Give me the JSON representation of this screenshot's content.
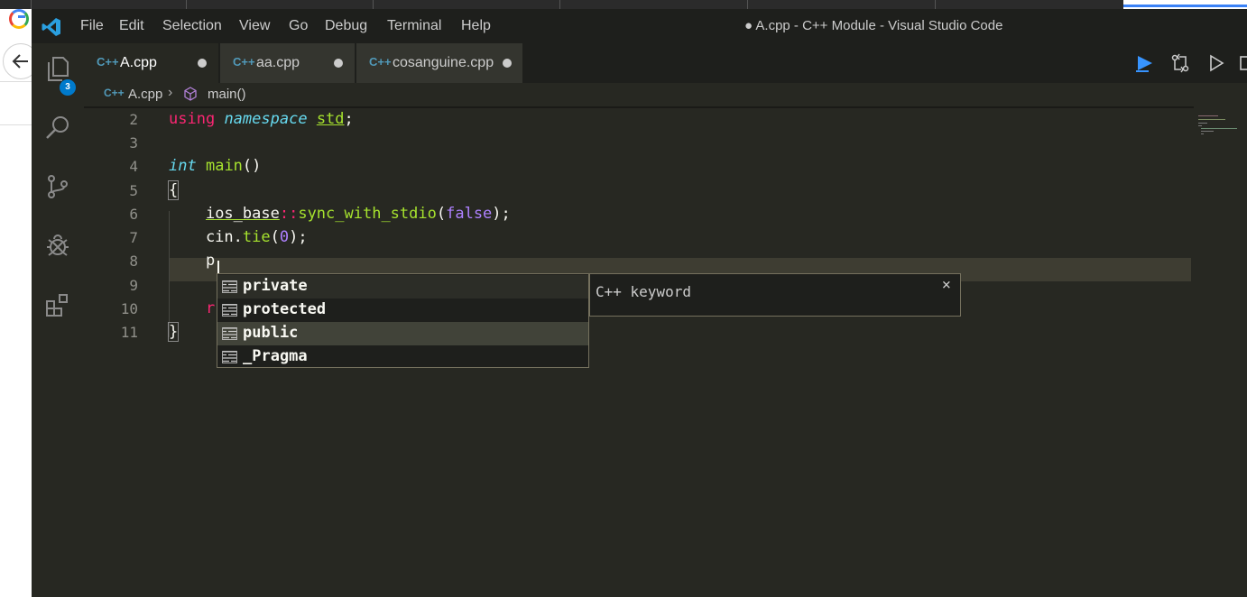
{
  "window": {
    "title": "● A.cpp - C++ Module - Visual Studio Code"
  },
  "menu": [
    "File",
    "Edit",
    "Selection",
    "View",
    "Go",
    "Debug",
    "Terminal",
    "Help"
  ],
  "activity": {
    "explorer_badge": "3",
    "icons": [
      "files-icon",
      "search-icon",
      "source-control-icon",
      "debug-icon",
      "extensions-icon"
    ]
  },
  "tabs": [
    {
      "icon_text": "C++",
      "label": "A.cpp",
      "dirty": true,
      "active": true
    },
    {
      "icon_text": "C++",
      "label": "aa.cpp",
      "dirty": true,
      "active": false
    },
    {
      "icon_text": "C++",
      "label": "cosanguine.cpp",
      "dirty": true,
      "active": false
    }
  ],
  "breadcrumb": {
    "icon_text": "C++",
    "file": "A.cpp",
    "symbol": "main()"
  },
  "editor": {
    "line_numbers": [
      "2",
      "3",
      "4",
      "5",
      "6",
      "7",
      "8",
      "9",
      "10",
      "11"
    ],
    "current_line": "8",
    "typed_text": "p"
  },
  "suggestions": {
    "items": [
      "private",
      "protected",
      "public",
      "_Pragma"
    ],
    "focused_item": "public",
    "detail": "C++ keyword",
    "close_symbol": "×"
  },
  "colors": {
    "editor_bg": "#272822",
    "titlebar_bg": "#1e1f1c",
    "keyword": "#f92672",
    "type": "#66d9ef",
    "function": "#a6e22e",
    "number": "#ae81ff",
    "accent": "#007acc",
    "play": "#3794ff"
  }
}
